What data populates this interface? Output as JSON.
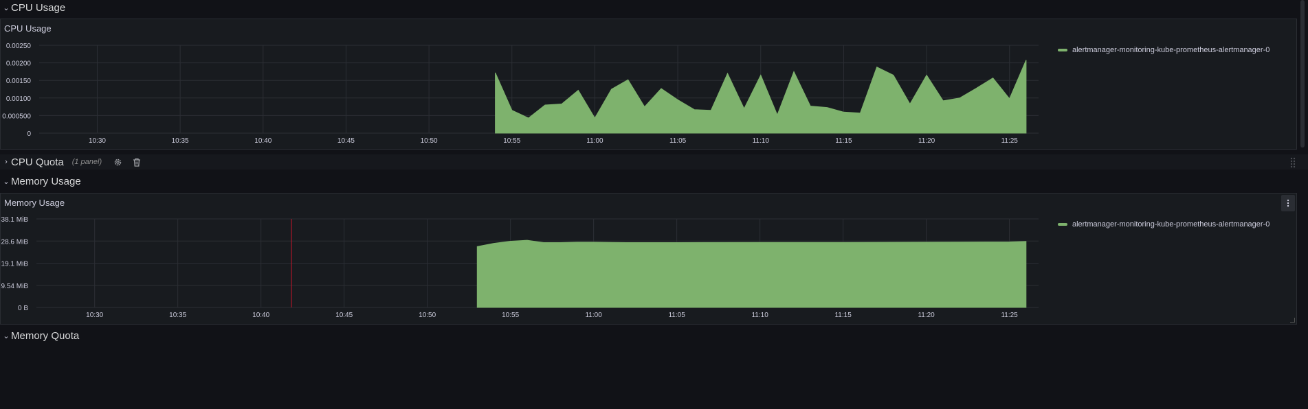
{
  "rows": {
    "cpu_usage": {
      "title": "CPU Usage"
    },
    "cpu_quota": {
      "title": "CPU Quota",
      "meta": "(1 panel)"
    },
    "memory_usage": {
      "title": "Memory Usage"
    },
    "memory_quota": {
      "title": "Memory Quota"
    }
  },
  "panels": {
    "cpu": {
      "title": "CPU Usage",
      "legend": "alertmanager-monitoring-kube-prometheus-alertmanager-0"
    },
    "memory": {
      "title": "Memory Usage",
      "legend": "alertmanager-monitoring-kube-prometheus-alertmanager-0"
    }
  },
  "icons": {
    "settings": "gear-icon",
    "delete": "trash-icon",
    "menu": "kebab-menu-icon",
    "collapse": "chevron-down-icon",
    "expand": "chevron-right-icon"
  },
  "colors": {
    "series": "#7eb26d",
    "background": "#111217",
    "panel": "#181b1f",
    "annotation": "#c4162a"
  },
  "chart_data": [
    {
      "type": "area",
      "title": "CPU Usage",
      "x_ticks": [
        "10:30",
        "10:35",
        "10:40",
        "10:45",
        "10:50",
        "10:55",
        "11:00",
        "11:05",
        "11:10",
        "11:15",
        "11:20",
        "11:25"
      ],
      "y_ticks": [
        "0",
        "0.000500",
        "0.00100",
        "0.00150",
        "0.00200",
        "0.00250"
      ],
      "xlim": [
        "10:26:30",
        "11:27:00"
      ],
      "ylim": [
        0,
        0.0025
      ],
      "grid": true,
      "legend_position": "right",
      "series": [
        {
          "name": "alertmanager-monitoring-kube-prometheus-alertmanager-0",
          "x": [
            "10:54:00",
            "10:54:00",
            "10:55:00",
            "10:56:00",
            "10:57:00",
            "10:58:00",
            "10:59:00",
            "11:00:00",
            "11:01:00",
            "11:02:00",
            "11:03:00",
            "11:04:00",
            "11:05:00",
            "11:06:00",
            "11:07:00",
            "11:08:00",
            "11:09:00",
            "11:10:00",
            "11:11:00",
            "11:12:00",
            "11:13:00",
            "11:14:00",
            "11:15:00",
            "11:16:00",
            "11:17:00",
            "11:18:00",
            "11:19:00",
            "11:20:00",
            "11:21:00",
            "11:22:00",
            "11:23:00",
            "11:24:00",
            "11:25:00",
            "11:26:00"
          ],
          "values": [
            0,
            0.00172,
            0.00065,
            0.00043,
            0.0008,
            0.00083,
            0.00122,
            0.00043,
            0.00125,
            0.00152,
            0.00075,
            0.00127,
            0.00095,
            0.00067,
            0.00065,
            0.0017,
            0.0007,
            0.00165,
            0.00052,
            0.00175,
            0.00077,
            0.00073,
            0.0006,
            0.00057,
            0.00188,
            0.00165,
            0.00083,
            0.00165,
            0.00092,
            0.001,
            0.00128,
            0.00157,
            0.00098,
            0.00208
          ]
        }
      ]
    },
    {
      "type": "area",
      "title": "Memory Usage",
      "x_ticks": [
        "10:30",
        "10:35",
        "10:40",
        "10:45",
        "10:50",
        "10:55",
        "11:00",
        "11:05",
        "11:10",
        "11:15",
        "11:20",
        "11:25"
      ],
      "y_ticks": [
        "0 B",
        "9.54 MiB",
        "19.1 MiB",
        "28.6 MiB",
        "38.1 MiB"
      ],
      "xlim": [
        "10:26:30",
        "11:27:00"
      ],
      "ylim": [
        0,
        38.1
      ],
      "y_unit": "MiB",
      "grid": true,
      "annotation_time": "10:41:50",
      "legend_position": "right",
      "series": [
        {
          "name": "alertmanager-monitoring-kube-prometheus-alertmanager-0",
          "x": [
            "10:53:00",
            "10:53:00",
            "10:54:00",
            "10:55:00",
            "10:56:00",
            "10:57:00",
            "10:58:00",
            "10:59:00",
            "11:00:00",
            "11:02:00",
            "11:05:00",
            "11:10:00",
            "11:15:00",
            "11:20:00",
            "11:25:00",
            "11:26:00"
          ],
          "values": [
            0,
            26.2,
            27.6,
            28.5,
            28.9,
            27.9,
            27.9,
            28.1,
            28.1,
            27.9,
            27.9,
            28.0,
            28.0,
            28.1,
            28.2,
            28.4
          ]
        }
      ]
    }
  ]
}
